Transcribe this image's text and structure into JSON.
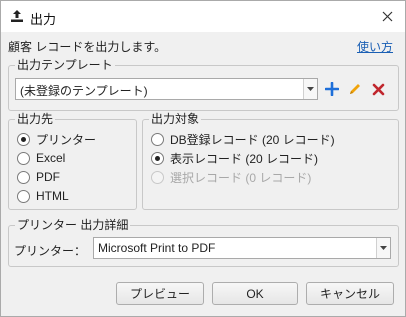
{
  "window": {
    "title": "出力",
    "close_icon": "close-icon",
    "title_icon": "export-icon"
  },
  "description": "顧客 レコードを出力します。",
  "help_link": "使い方",
  "template": {
    "legend": "出力テンプレート",
    "selected": "(未登録のテンプレート)",
    "actions": [
      {
        "name": "add-icon",
        "color": "#1e6fd9"
      },
      {
        "name": "edit-pencil-icon",
        "color": "#f0a30a"
      },
      {
        "name": "delete-icon",
        "color": "#c0262d"
      }
    ]
  },
  "destination": {
    "legend": "出力先",
    "options": [
      {
        "label": "プリンター",
        "checked": true,
        "disabled": false
      },
      {
        "label": "Excel",
        "checked": false,
        "disabled": false
      },
      {
        "label": "PDF",
        "checked": false,
        "disabled": false
      },
      {
        "label": "HTML",
        "checked": false,
        "disabled": false
      }
    ]
  },
  "target": {
    "legend": "出力対象",
    "options": [
      {
        "label": "DB登録レコード (20 レコード)",
        "checked": false,
        "disabled": false
      },
      {
        "label": "表示レコード (20 レコード)",
        "checked": true,
        "disabled": false
      },
      {
        "label": "選択レコード (0 レコード)",
        "checked": false,
        "disabled": true
      }
    ]
  },
  "detail": {
    "legend": "プリンター 出力詳細",
    "printer_label": "プリンター：",
    "printer_value": "Microsoft Print to PDF"
  },
  "buttons": {
    "preview": "プレビュー",
    "ok": "OK",
    "cancel": "キャンセル"
  }
}
